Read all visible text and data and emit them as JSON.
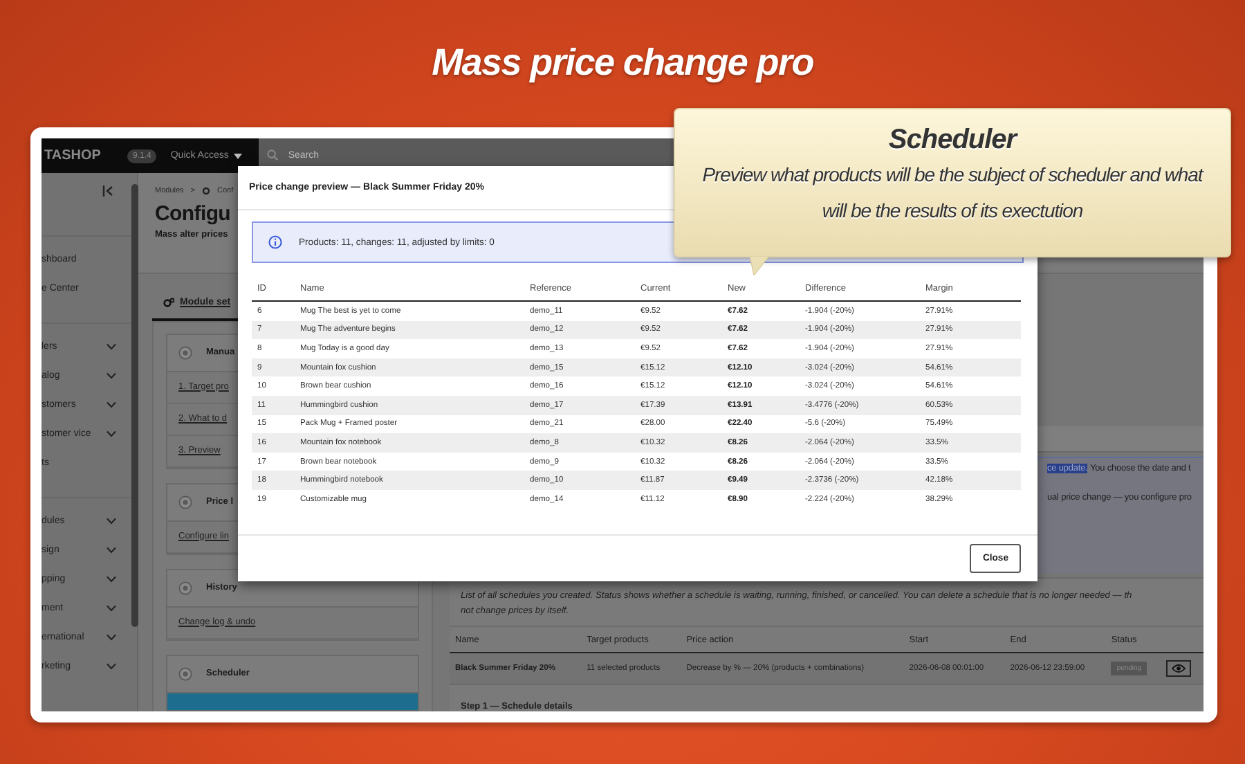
{
  "slide": {
    "title": "Mass price change pro"
  },
  "callout": {
    "title": "Scheduler",
    "text": "Preview what products will be the subject of scheduler and what will be the results of its exectution"
  },
  "topbar": {
    "logo": "TASHOP",
    "version": "9.1.4",
    "quick_access": "Quick Access",
    "search": {
      "placeholder": "Search"
    }
  },
  "sidebar": {
    "groups": [
      [
        {
          "label": "shboard",
          "expandable": false
        },
        {
          "label": "e Center",
          "expandable": false
        }
      ],
      [
        {
          "label": "lers",
          "expandable": true
        },
        {
          "label": "alog",
          "expandable": true
        },
        {
          "label": "stomers",
          "expandable": true
        },
        {
          "label": "stomer vice",
          "expandable": true
        },
        {
          "label": "ts",
          "expandable": false
        }
      ],
      [
        {
          "label": "dules",
          "expandable": true
        },
        {
          "label": "sign",
          "expandable": true
        },
        {
          "label": "pping",
          "expandable": true
        },
        {
          "label": "ment",
          "expandable": true
        },
        {
          "label": "ernational",
          "expandable": true
        },
        {
          "label": "rketing",
          "expandable": true
        }
      ]
    ]
  },
  "page": {
    "breadcrumb": {
      "items": [
        "Modules",
        "Conf"
      ],
      "separator": ">"
    },
    "title": "Configu",
    "subtitle": "Mass alter prices",
    "tabs": [
      {
        "label": "Module set",
        "selected": true
      }
    ],
    "panels": [
      {
        "title": "Manua",
        "links": [
          "1. Target pro",
          "2. What to d",
          "3. Preview"
        ],
        "highlighted": false
      },
      {
        "title": "Price l",
        "links": [
          "Configure lin"
        ],
        "highlighted": false
      },
      {
        "title": "History",
        "links": [
          "Change log & undo"
        ],
        "highlighted": false
      },
      {
        "title": "Scheduler",
        "highlighted": true
      }
    ],
    "notice": {
      "lines": [
        [
          {
            "text": "ce update.",
            "highlighted": true
          },
          {
            "text": " You choose the date and t",
            "highlighted": false
          }
        ],
        [
          {
            "text": "ual price change — you configure pro",
            "highlighted": false
          }
        ]
      ]
    },
    "schedules": {
      "description": [
        "List of all schedules you created. Status shows whether a schedule is waiting, running, finished, or cancelled. You can delete a schedule that is no longer needed — th",
        "not change prices by itself."
      ],
      "columns": [
        "Name",
        "Target products",
        "Price action",
        "Start",
        "End",
        "Status"
      ],
      "rows": [
        {
          "cells": [
            "Black Summer Friday 20%",
            "11 selected products",
            "Decrease by % — 20% (products + combinations)",
            "2026-06-08 00:01:00",
            "2026-06-12 23:59:00"
          ],
          "status": "pending"
        }
      ],
      "step_title": "Step 1 — Schedule details"
    }
  },
  "dialog": {
    "title": "Price change preview — Black Summer Friday 20%",
    "info": "Products: 11, changes: 11, adjusted by limits: 0",
    "columns": [
      "ID",
      "Name",
      "Reference",
      "Current",
      "New",
      "Difference",
      "Margin"
    ],
    "rows": [
      [
        "6",
        "Mug The best is yet to come",
        "demo_11",
        "€9.52",
        "€7.62",
        "-1.904 (-20%)",
        "27.91%"
      ],
      [
        "7",
        "Mug The adventure begins",
        "demo_12",
        "€9.52",
        "€7.62",
        "-1.904 (-20%)",
        "27.91%"
      ],
      [
        "8",
        "Mug Today is a good day",
        "demo_13",
        "€9.52",
        "€7.62",
        "-1.904 (-20%)",
        "27.91%"
      ],
      [
        "9",
        "Mountain fox cushion",
        "demo_15",
        "€15.12",
        "€12.10",
        "-3.024 (-20%)",
        "54.61%"
      ],
      [
        "10",
        "Brown bear cushion",
        "demo_16",
        "€15.12",
        "€12.10",
        "-3.024 (-20%)",
        "54.61%"
      ],
      [
        "11",
        "Hummingbird cushion",
        "demo_17",
        "€17.39",
        "€13.91",
        "-3.4776 (-20%)",
        "60.53%"
      ],
      [
        "15",
        "Pack Mug + Framed poster",
        "demo_21",
        "€28.00",
        "€22.40",
        "-5.6 (-20%)",
        "75.49%"
      ],
      [
        "16",
        "Mountain fox notebook",
        "demo_8",
        "€10.32",
        "€8.26",
        "-2.064 (-20%)",
        "33.5%"
      ],
      [
        "17",
        "Brown bear notebook",
        "demo_9",
        "€10.32",
        "€8.26",
        "-2.064 (-20%)",
        "33.5%"
      ],
      [
        "18",
        "Hummingbird notebook",
        "demo_10",
        "€11.87",
        "€9.49",
        "-2.3736 (-20%)",
        "42.18%"
      ],
      [
        "19",
        "Customizable mug",
        "demo_14",
        "€11.12",
        "€8.90",
        "-2.224 (-20%)",
        "38.29%"
      ]
    ],
    "close": "Close"
  }
}
